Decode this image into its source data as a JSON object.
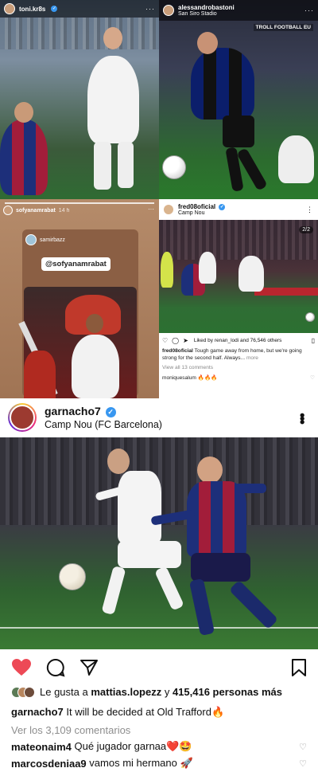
{
  "cells": {
    "toni": {
      "username": "toni.kr8s",
      "more": "···"
    },
    "robastoni": {
      "username": "alessandrobastoni",
      "location": "San Siro Stadio",
      "watermark": "TROLL FOOTBALL EU",
      "more": "···"
    },
    "story": {
      "username": "sofyanamrabat",
      "time": "14 h",
      "inner_user": "samirbazz",
      "mention": "@sofyanamrabat",
      "more": "···"
    },
    "fred": {
      "username": "fred08oficial",
      "location": "Camp Nou",
      "page_indicator": "2/2",
      "likes_text": "Liked by renan_lodi and 76,546 others",
      "caption_user": "fred08oficial",
      "caption_text": "Tough game away from home, but we're going strong for the second half. Always...",
      "caption_more": "more",
      "view_comments": "View all 13 comments",
      "comment_user": "moniquesalum",
      "comment_text": "🔥🔥🔥",
      "more": "⋮"
    }
  },
  "main_post": {
    "username": "garnacho7",
    "location": "Camp Nou (FC Barcelona)",
    "liked_by_prefix": "Le gusta a",
    "liked_by_user": "mattias.lopezz",
    "liked_by_mid": "y",
    "liked_by_count": "415,416 personas más",
    "caption_user": "garnacho7",
    "caption_text": "It will be decided at Old Trafford🔥",
    "view_comments": "Ver los 3,109 comentarios",
    "comments": [
      {
        "user": "mateonaim4",
        "text": "Qué jugador garnaa❤️🤩"
      },
      {
        "user": "marcosdeniaa9",
        "text": "vamos mi hermano 🚀"
      }
    ]
  },
  "colors": {
    "like_red": "#ed4956",
    "verified_blue": "#3897f0",
    "muted_gray": "#8e8e8e"
  },
  "icons": [
    "heart-icon",
    "comment-icon",
    "share-icon",
    "bookmark-icon",
    "verified-icon",
    "more-icon"
  ]
}
